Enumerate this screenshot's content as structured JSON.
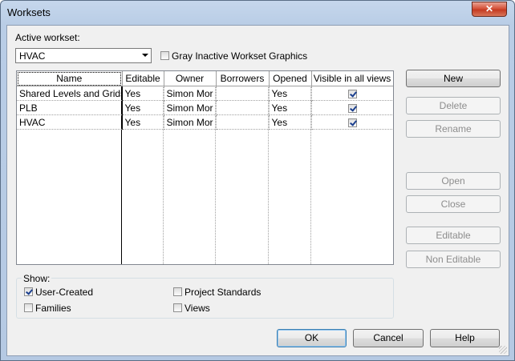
{
  "window": {
    "title": "Worksets",
    "close_glyph": "✕"
  },
  "active_workset": {
    "label": "Active workset:",
    "value": "HVAC"
  },
  "gray_inactive": {
    "label": "Gray Inactive Workset Graphics",
    "checked": false
  },
  "table": {
    "columns": [
      "Name",
      "Editable",
      "Owner",
      "Borrowers",
      "Opened",
      "Visible in all views"
    ],
    "rows": [
      {
        "name": "Shared Levels and Grids",
        "editable": "Yes",
        "owner": "Simon Mor",
        "borrowers": "",
        "opened": "Yes",
        "visible": true
      },
      {
        "name": "PLB",
        "editable": "Yes",
        "owner": "Simon Mor",
        "borrowers": "",
        "opened": "Yes",
        "visible": true
      },
      {
        "name": "HVAC",
        "editable": "Yes",
        "owner": "Simon Mor",
        "borrowers": "",
        "opened": "Yes",
        "visible": true
      }
    ]
  },
  "side_buttons": {
    "new": "New",
    "delete": "Delete",
    "rename": "Rename",
    "open": "Open",
    "close": "Close",
    "editable": "Editable",
    "non_editable": "Non Editable"
  },
  "show": {
    "label": "Show:",
    "user_created": {
      "label": "User-Created",
      "checked": true
    },
    "families": {
      "label": "Families",
      "checked": false
    },
    "project_standards": {
      "label": "Project Standards",
      "checked": false
    },
    "views": {
      "label": "Views",
      "checked": false
    }
  },
  "footer": {
    "ok": "OK",
    "cancel": "Cancel",
    "help": "Help"
  },
  "colors": {
    "title_bar": "#b9cde6",
    "close_button": "#c43b22",
    "check_mark": "#1b3f8e",
    "default_button_border": "#3c7fb1"
  }
}
